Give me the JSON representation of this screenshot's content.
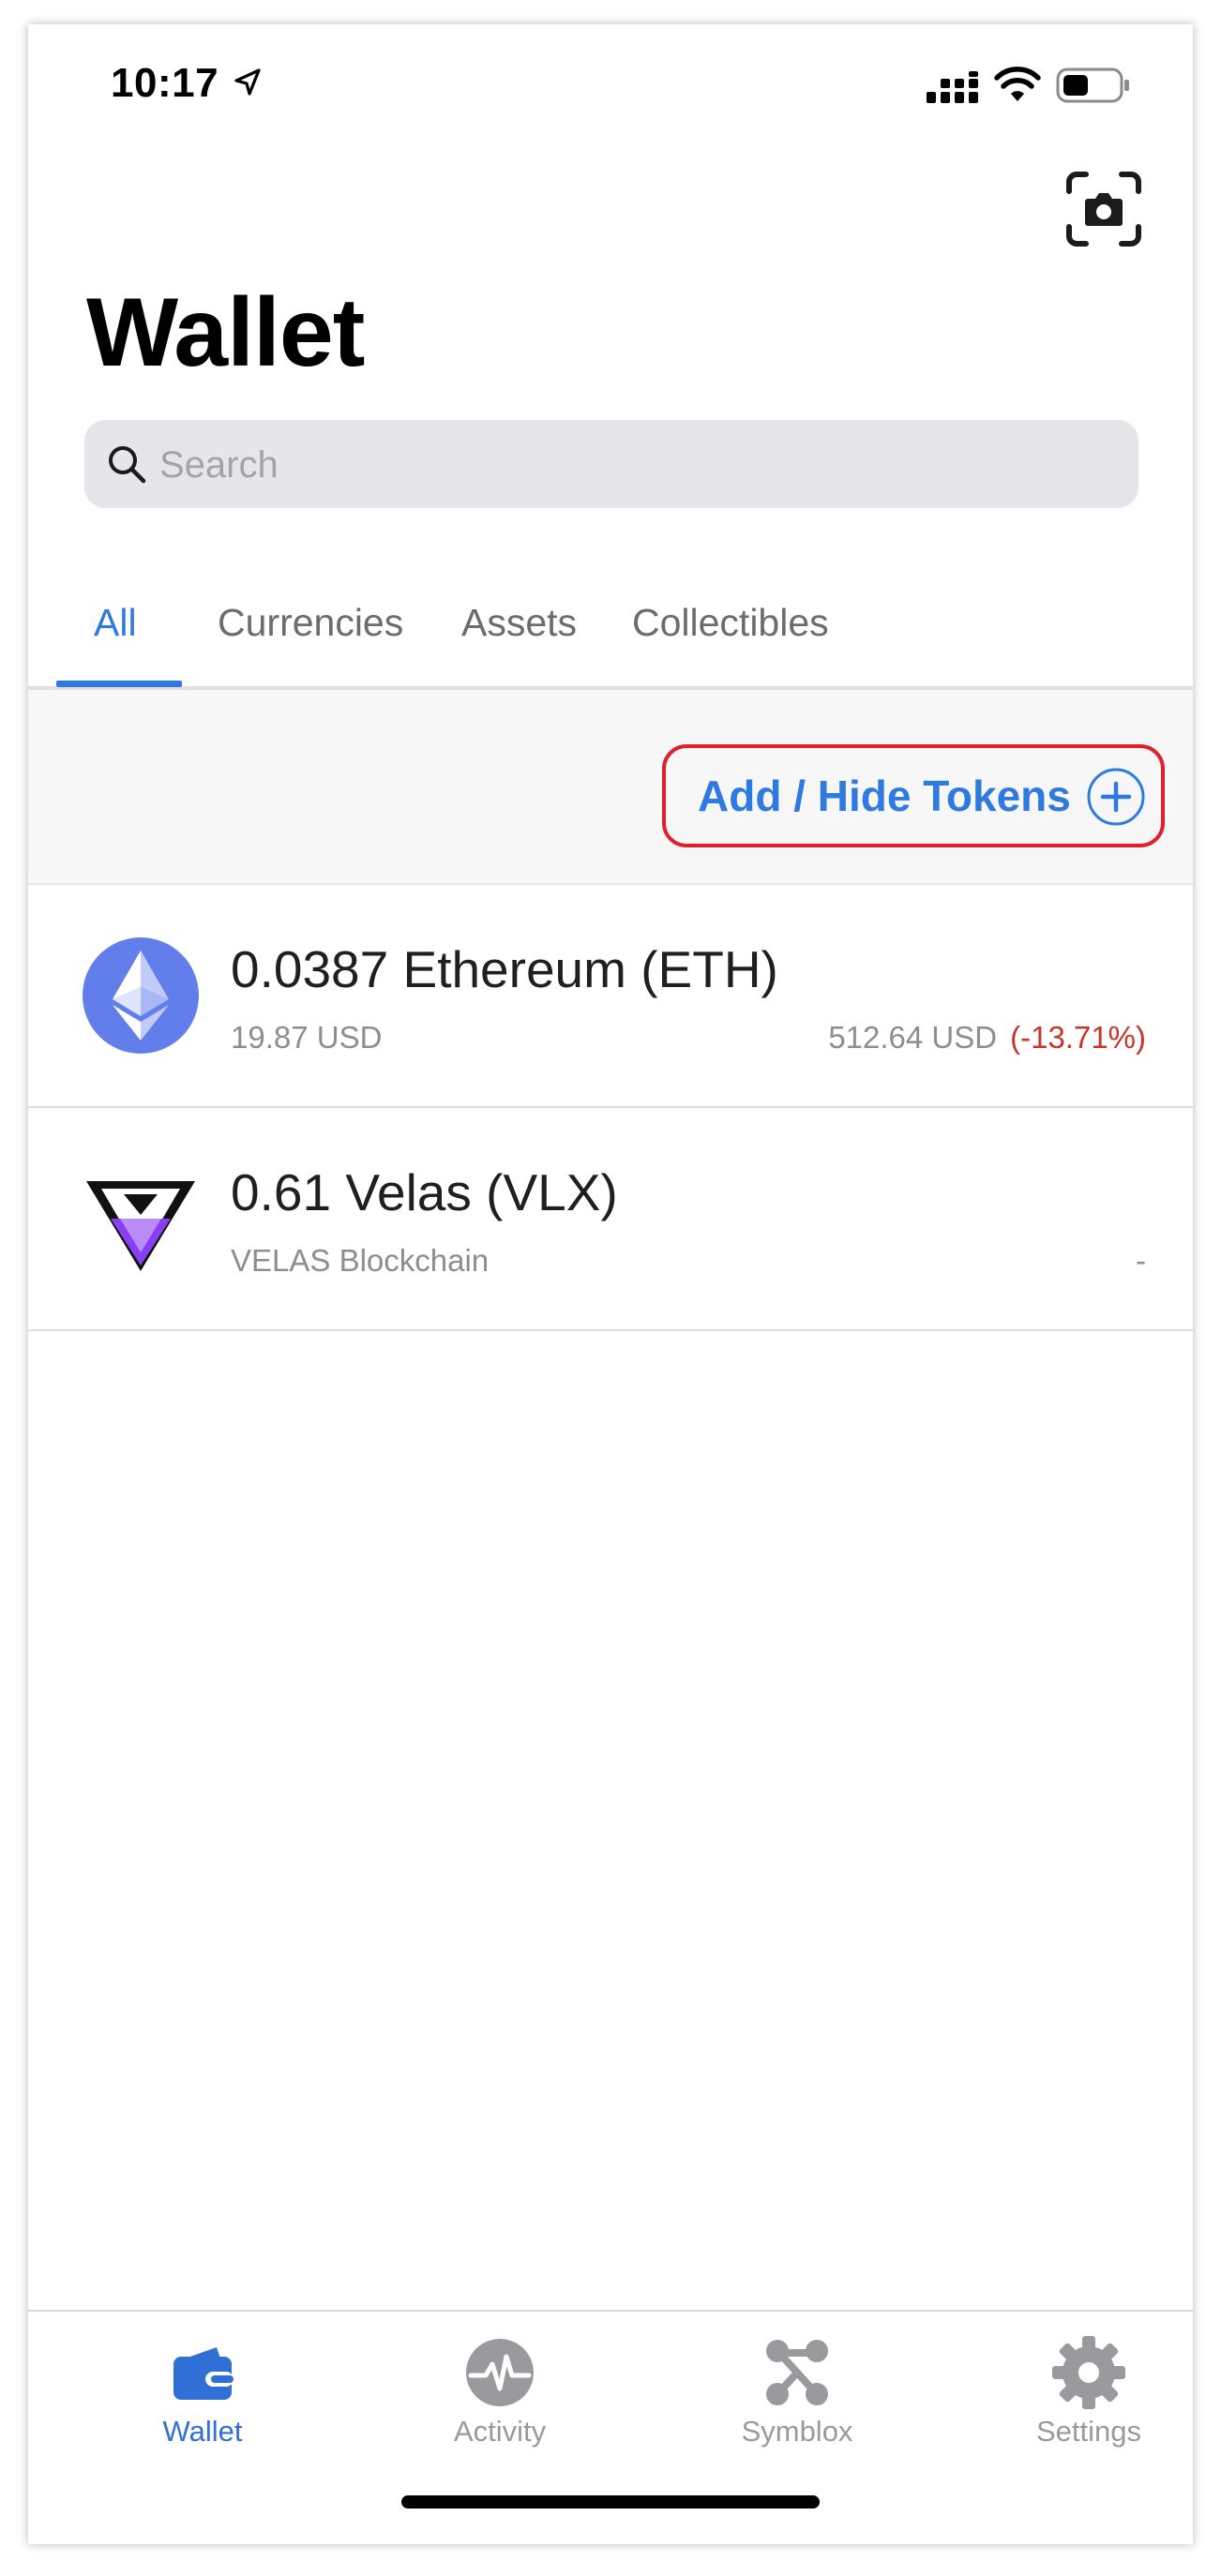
{
  "status": {
    "time": "10:17"
  },
  "header": {
    "title": "Wallet"
  },
  "search": {
    "placeholder": "Search"
  },
  "tabs": [
    {
      "label": "All",
      "active": true
    },
    {
      "label": "Currencies",
      "active": false
    },
    {
      "label": "Assets",
      "active": false
    },
    {
      "label": "Collectibles",
      "active": false
    }
  ],
  "token_bar": {
    "add_hide_label": "Add / Hide Tokens"
  },
  "assets": [
    {
      "name": "0.0387 Ethereum (ETH)",
      "sub": "19.87 USD",
      "price": "512.64 USD",
      "change": "(-13.71%)",
      "icon": "ethereum-icon"
    },
    {
      "name": "0.61 Velas (VLX)",
      "sub": "VELAS Blockchain",
      "price": "-",
      "change": "",
      "icon": "velas-icon"
    }
  ],
  "nav": [
    {
      "label": "Wallet",
      "icon": "wallet-icon",
      "active": true
    },
    {
      "label": "Activity",
      "icon": "activity-icon",
      "active": false
    },
    {
      "label": "Symblox",
      "icon": "symblox-icon",
      "active": false
    },
    {
      "label": "Settings",
      "icon": "gear-icon",
      "active": false
    }
  ],
  "colors": {
    "accent": "#2f7ae0",
    "highlight_border": "#e0202b",
    "negative": "#c8342c",
    "eth": "#627eea",
    "velas": "#8b3ff2"
  }
}
